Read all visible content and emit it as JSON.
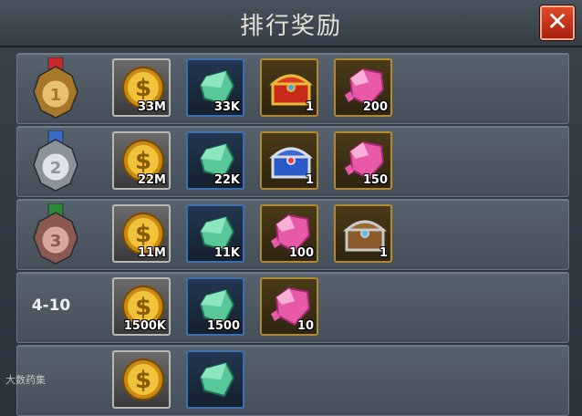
{
  "window": {
    "title": "排行奖励",
    "close_symbol": "✕"
  },
  "rows": [
    {
      "rank": "1",
      "medal": "gold-medal",
      "items": [
        {
          "icon": "gold-coin",
          "frame": "gray",
          "qty": "33M"
        },
        {
          "icon": "green-crystal",
          "frame": "blue",
          "qty": "33K"
        },
        {
          "icon": "red-treasure-chest",
          "frame": "gold",
          "qty": "1"
        },
        {
          "icon": "pink-diamond",
          "frame": "gold",
          "qty": "200"
        }
      ]
    },
    {
      "rank": "2",
      "medal": "silver-medal",
      "items": [
        {
          "icon": "gold-coin",
          "frame": "gray",
          "qty": "22M"
        },
        {
          "icon": "green-crystal",
          "frame": "blue",
          "qty": "22K"
        },
        {
          "icon": "blue-treasure-chest",
          "frame": "gold",
          "qty": "1"
        },
        {
          "icon": "pink-diamond",
          "frame": "gold",
          "qty": "150"
        }
      ]
    },
    {
      "rank": "3",
      "medal": "bronze-medal",
      "items": [
        {
          "icon": "gold-coin",
          "frame": "gray",
          "qty": "11M"
        },
        {
          "icon": "green-crystal",
          "frame": "blue",
          "qty": "11K"
        },
        {
          "icon": "pink-diamond",
          "frame": "gold",
          "qty": "100"
        },
        {
          "icon": "wooden-treasure-chest",
          "frame": "gold",
          "qty": "1"
        }
      ]
    },
    {
      "rank": "4-10",
      "medal": "",
      "items": [
        {
          "icon": "gold-coin",
          "frame": "gray",
          "qty": "1500K"
        },
        {
          "icon": "green-crystal",
          "frame": "blue",
          "qty": "1500"
        },
        {
          "icon": "pink-diamond",
          "frame": "gold",
          "qty": "10"
        }
      ]
    },
    {
      "rank": "",
      "medal": "",
      "items": [
        {
          "icon": "gold-coin",
          "frame": "gray",
          "qty": ""
        },
        {
          "icon": "green-crystal",
          "frame": "blue",
          "qty": ""
        }
      ]
    }
  ],
  "watermark": "大数药集",
  "colors": {
    "close_bg": "#c8301a",
    "row_bg": "#505c68",
    "gold_frame": "#b08a32",
    "blue_frame": "#3c6fb0",
    "gray_frame": "#b8b8b8"
  }
}
